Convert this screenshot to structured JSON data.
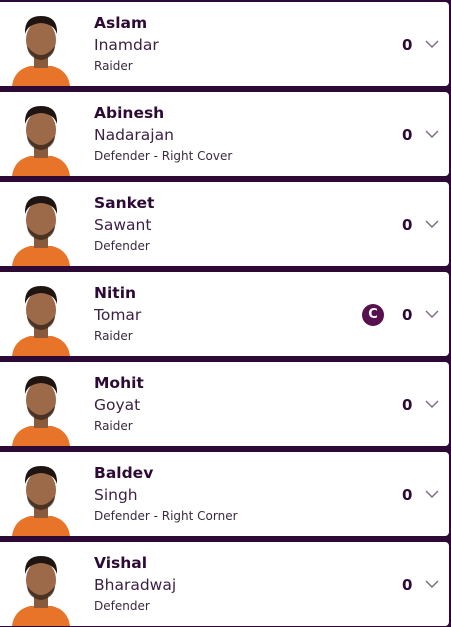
{
  "players": [
    {
      "first": "Aslam",
      "last": "Inamdar",
      "role": "Raider",
      "points": "0",
      "captain": false
    },
    {
      "first": "Abinesh",
      "last": "Nadarajan",
      "role": "Defender - Right Cover",
      "points": "0",
      "captain": false
    },
    {
      "first": "Sanket",
      "last": "Sawant",
      "role": "Defender",
      "points": "0",
      "captain": false
    },
    {
      "first": "Nitin",
      "last": "Tomar",
      "role": "Raider",
      "points": "0",
      "captain": true
    },
    {
      "first": "Mohit",
      "last": "Goyat",
      "role": "Raider",
      "points": "0",
      "captain": false
    },
    {
      "first": "Baldev",
      "last": "Singh",
      "role": "Defender - Right Corner",
      "points": "0",
      "captain": false
    },
    {
      "first": "Vishal",
      "last": "Bharadwaj",
      "role": "Defender",
      "points": "0",
      "captain": false
    }
  ],
  "captain_badge": "C",
  "colors": {
    "background": "#2c0a35",
    "card": "#ffffff",
    "name": "#2c0a35",
    "captain_badge": "#57114f",
    "jersey": "#e8742a"
  },
  "icons": {
    "expand": "chevron-down-icon",
    "photo": "player-photo"
  }
}
